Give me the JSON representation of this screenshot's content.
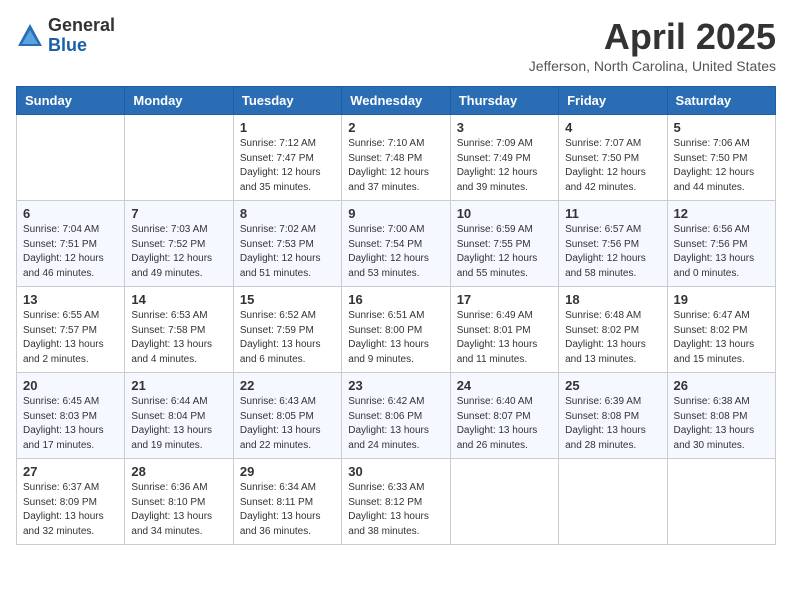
{
  "header": {
    "logo_general": "General",
    "logo_blue": "Blue",
    "month_title": "April 2025",
    "location": "Jefferson, North Carolina, United States"
  },
  "days_of_week": [
    "Sunday",
    "Monday",
    "Tuesday",
    "Wednesday",
    "Thursday",
    "Friday",
    "Saturday"
  ],
  "weeks": [
    [
      {
        "day": "",
        "info": ""
      },
      {
        "day": "",
        "info": ""
      },
      {
        "day": "1",
        "info": "Sunrise: 7:12 AM\nSunset: 7:47 PM\nDaylight: 12 hours and 35 minutes."
      },
      {
        "day": "2",
        "info": "Sunrise: 7:10 AM\nSunset: 7:48 PM\nDaylight: 12 hours and 37 minutes."
      },
      {
        "day": "3",
        "info": "Sunrise: 7:09 AM\nSunset: 7:49 PM\nDaylight: 12 hours and 39 minutes."
      },
      {
        "day": "4",
        "info": "Sunrise: 7:07 AM\nSunset: 7:50 PM\nDaylight: 12 hours and 42 minutes."
      },
      {
        "day": "5",
        "info": "Sunrise: 7:06 AM\nSunset: 7:50 PM\nDaylight: 12 hours and 44 minutes."
      }
    ],
    [
      {
        "day": "6",
        "info": "Sunrise: 7:04 AM\nSunset: 7:51 PM\nDaylight: 12 hours and 46 minutes."
      },
      {
        "day": "7",
        "info": "Sunrise: 7:03 AM\nSunset: 7:52 PM\nDaylight: 12 hours and 49 minutes."
      },
      {
        "day": "8",
        "info": "Sunrise: 7:02 AM\nSunset: 7:53 PM\nDaylight: 12 hours and 51 minutes."
      },
      {
        "day": "9",
        "info": "Sunrise: 7:00 AM\nSunset: 7:54 PM\nDaylight: 12 hours and 53 minutes."
      },
      {
        "day": "10",
        "info": "Sunrise: 6:59 AM\nSunset: 7:55 PM\nDaylight: 12 hours and 55 minutes."
      },
      {
        "day": "11",
        "info": "Sunrise: 6:57 AM\nSunset: 7:56 PM\nDaylight: 12 hours and 58 minutes."
      },
      {
        "day": "12",
        "info": "Sunrise: 6:56 AM\nSunset: 7:56 PM\nDaylight: 13 hours and 0 minutes."
      }
    ],
    [
      {
        "day": "13",
        "info": "Sunrise: 6:55 AM\nSunset: 7:57 PM\nDaylight: 13 hours and 2 minutes."
      },
      {
        "day": "14",
        "info": "Sunrise: 6:53 AM\nSunset: 7:58 PM\nDaylight: 13 hours and 4 minutes."
      },
      {
        "day": "15",
        "info": "Sunrise: 6:52 AM\nSunset: 7:59 PM\nDaylight: 13 hours and 6 minutes."
      },
      {
        "day": "16",
        "info": "Sunrise: 6:51 AM\nSunset: 8:00 PM\nDaylight: 13 hours and 9 minutes."
      },
      {
        "day": "17",
        "info": "Sunrise: 6:49 AM\nSunset: 8:01 PM\nDaylight: 13 hours and 11 minutes."
      },
      {
        "day": "18",
        "info": "Sunrise: 6:48 AM\nSunset: 8:02 PM\nDaylight: 13 hours and 13 minutes."
      },
      {
        "day": "19",
        "info": "Sunrise: 6:47 AM\nSunset: 8:02 PM\nDaylight: 13 hours and 15 minutes."
      }
    ],
    [
      {
        "day": "20",
        "info": "Sunrise: 6:45 AM\nSunset: 8:03 PM\nDaylight: 13 hours and 17 minutes."
      },
      {
        "day": "21",
        "info": "Sunrise: 6:44 AM\nSunset: 8:04 PM\nDaylight: 13 hours and 19 minutes."
      },
      {
        "day": "22",
        "info": "Sunrise: 6:43 AM\nSunset: 8:05 PM\nDaylight: 13 hours and 22 minutes."
      },
      {
        "day": "23",
        "info": "Sunrise: 6:42 AM\nSunset: 8:06 PM\nDaylight: 13 hours and 24 minutes."
      },
      {
        "day": "24",
        "info": "Sunrise: 6:40 AM\nSunset: 8:07 PM\nDaylight: 13 hours and 26 minutes."
      },
      {
        "day": "25",
        "info": "Sunrise: 6:39 AM\nSunset: 8:08 PM\nDaylight: 13 hours and 28 minutes."
      },
      {
        "day": "26",
        "info": "Sunrise: 6:38 AM\nSunset: 8:08 PM\nDaylight: 13 hours and 30 minutes."
      }
    ],
    [
      {
        "day": "27",
        "info": "Sunrise: 6:37 AM\nSunset: 8:09 PM\nDaylight: 13 hours and 32 minutes."
      },
      {
        "day": "28",
        "info": "Sunrise: 6:36 AM\nSunset: 8:10 PM\nDaylight: 13 hours and 34 minutes."
      },
      {
        "day": "29",
        "info": "Sunrise: 6:34 AM\nSunset: 8:11 PM\nDaylight: 13 hours and 36 minutes."
      },
      {
        "day": "30",
        "info": "Sunrise: 6:33 AM\nSunset: 8:12 PM\nDaylight: 13 hours and 38 minutes."
      },
      {
        "day": "",
        "info": ""
      },
      {
        "day": "",
        "info": ""
      },
      {
        "day": "",
        "info": ""
      }
    ]
  ]
}
